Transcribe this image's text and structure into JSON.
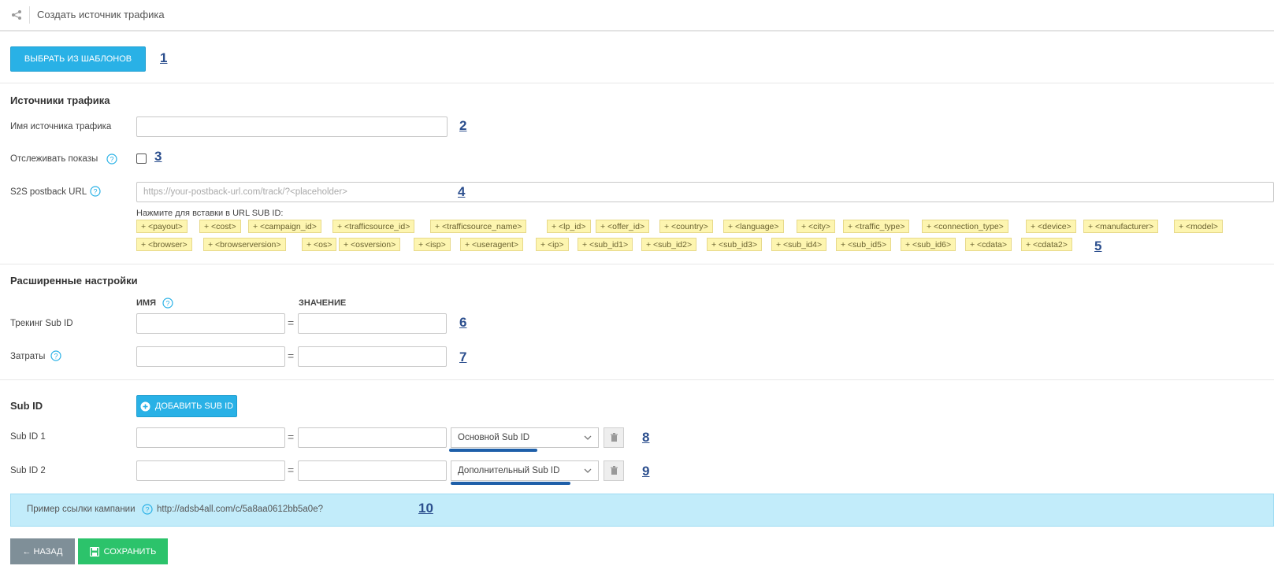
{
  "header": {
    "title": "Создать источник трафика",
    "icon": "share-icon"
  },
  "template_button": {
    "label": "ВЫБРАТЬ ИЗ ШАБЛОНОВ"
  },
  "traffic_sources": {
    "title": "Источники трафика",
    "name_label": "Имя источника трафика",
    "name_value": "",
    "track_impressions_label": "Отслеживать показы",
    "track_impressions_checked": false,
    "postback_label": "S2S postback URL",
    "postback_placeholder": "https://your-postback-url.com/track/?<placeholder>",
    "tokens_hint": "Нажмите для вставки в URL SUB ID:",
    "tokens_row1": [
      "+ <payout>",
      "+ <cost>",
      "+ <campaign_id>",
      "+ <trafficsource_id>",
      "+ <trafficsource_name>",
      "+ <lp_id>",
      "+ <offer_id>",
      "+ <country>",
      "+ <language>",
      "+ <city>",
      "+ <traffic_type>",
      "+ <connection_type>",
      "+ <device>",
      "+ <manufacturer>",
      "+ <model>"
    ],
    "tokens_row2": [
      "+ <browser>",
      "+ <browserversion>",
      "+ <os>",
      "+ <osversion>",
      "+ <isp>",
      "+ <useragent>",
      "+ <ip>",
      "+ <sub_id1>",
      "+ <sub_id2>",
      "+ <sub_id3>",
      "+ <sub_id4>",
      "+ <sub_id5>",
      "+ <sub_id6>",
      "+ <cdata>",
      "+ <cdata2>"
    ]
  },
  "advanced": {
    "title": "Расширенные настройки",
    "col_name": "ИМЯ",
    "col_value": "ЗНАЧЕНИЕ",
    "tracking_label": "Трекинг Sub ID",
    "costs_label": "Затраты",
    "equals": "="
  },
  "subid": {
    "title": "Sub ID",
    "add_label": "ДОБАВИТЬ SUB ID",
    "rows": [
      {
        "label": "Sub ID 1",
        "type": "Основной Sub ID"
      },
      {
        "label": "Sub ID 2",
        "type": "Дополнительный Sub ID"
      }
    ]
  },
  "campaign_example": {
    "label": "Пример ссылки кампании",
    "url": "http://adsb4all.com/c/5a8aa0612bb5a0e?"
  },
  "footer": {
    "back_label": "← НАЗАД",
    "save_label": "СОХРАНИТЬ"
  },
  "markers": [
    "1",
    "2",
    "3",
    "4",
    "5",
    "6",
    "7",
    "8",
    "9",
    "10"
  ],
  "colors": {
    "primary": "#29b1e6",
    "save": "#2cc36b",
    "back": "#7f8f98",
    "token_bg": "#fdf5b0",
    "info_bg": "#c2ecfa",
    "marker": "#2c4f8e"
  }
}
